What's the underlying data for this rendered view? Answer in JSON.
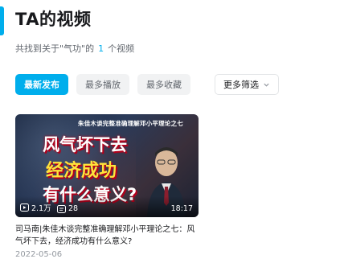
{
  "header": {
    "title": "TA的视频",
    "subtitle_prefix": "共找到关于\"气功\"的",
    "count": "1",
    "subtitle_suffix": "个视频",
    "accent_color": "#00aeec"
  },
  "tabs": [
    {
      "label": "最新发布",
      "active": true
    },
    {
      "label": "最多播放",
      "active": false
    },
    {
      "label": "最多收藏",
      "active": false
    }
  ],
  "filter": {
    "label": "更多筛选",
    "icon": "chevron-down-icon"
  },
  "video": {
    "thumbnail": {
      "banner": "朱佳木谈完整准确理解邓小平理论之七",
      "line1": "风气坏下去",
      "line2": "经济成功",
      "line3": "有什么意义?"
    },
    "views": "2.1万",
    "comments": "28",
    "duration": "18:17",
    "title": "司马南|朱佳木谈完整准确理解邓小平理论之七：风气坏下去，经济成功有什么意义?",
    "date": "2022-05-06"
  }
}
